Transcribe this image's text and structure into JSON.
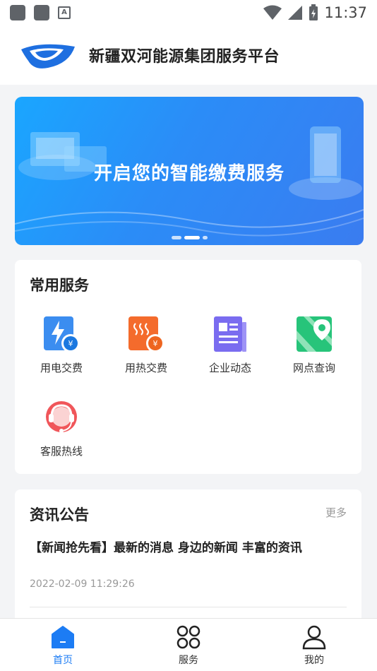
{
  "status_bar": {
    "time": "11:37"
  },
  "header": {
    "title": "新疆双河能源集团服务平台"
  },
  "banner": {
    "text": "开启您的智能缴费服务"
  },
  "services": {
    "title": "常用服务",
    "items": [
      {
        "label": "用电交费",
        "icon": "electricity-payment-icon"
      },
      {
        "label": "用热交费",
        "icon": "heating-payment-icon"
      },
      {
        "label": "企业动态",
        "icon": "news-document-icon"
      },
      {
        "label": "网点查询",
        "icon": "map-location-icon"
      },
      {
        "label": "客服热线",
        "icon": "customer-service-icon"
      }
    ]
  },
  "news": {
    "title": "资讯公告",
    "more": "更多",
    "items": [
      {
        "title": "【新闻抢先看】最新的消息 身边的新闻 丰富的资讯",
        "time": "2022-02-09 11:29:26"
      }
    ]
  },
  "tabbar": {
    "items": [
      {
        "label": "首页",
        "active": true
      },
      {
        "label": "服务",
        "active": false
      },
      {
        "label": "我的",
        "active": false
      }
    ]
  },
  "colors": {
    "accent": "#1c7cf4",
    "background": "#f3f4f6"
  }
}
